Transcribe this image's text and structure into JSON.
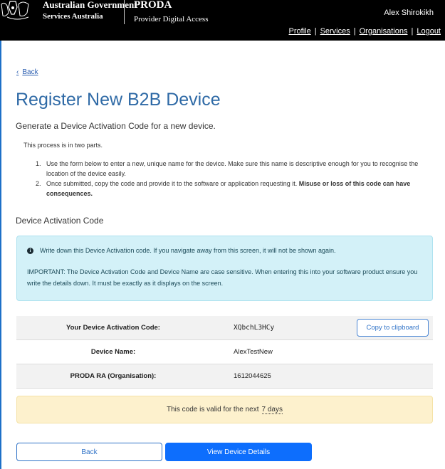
{
  "header": {
    "gov_name": "Australian Government",
    "gov_sub": "Services Australia",
    "app_name": "PRODA",
    "app_sub": "Provider Digital Access",
    "user_name": "Alex Shirokikh",
    "links": [
      "Profile",
      "Services",
      "Organisations",
      "Logout"
    ],
    "link_separator": "|",
    "crest_icon": "coat-of-arms-icon"
  },
  "nav": {
    "back_label": "Back",
    "back_icon": "chevron-left-icon"
  },
  "page": {
    "title": "Register New B2B Device",
    "lead": "Generate a Device Activation Code for a new device.",
    "intro": "This process is in two parts.",
    "steps": [
      {
        "num": "1.",
        "text": "Use the form below to enter a new, unique name for the device. Make sure this name is descriptive enough for you to recognise the location of the device easily.",
        "bold": ""
      },
      {
        "num": "2.",
        "text": "Once submitted, copy the code and provide it to the software or application requesting it.",
        "bold": "Misuse or loss of this code can have consequences."
      }
    ],
    "section_heading": "Device Activation Code"
  },
  "info_alert": {
    "icon": "info-circle-icon",
    "line1": "Write down this Device Activation code. If you navigate away from this screen, it will not be shown again.",
    "line2": "IMPORTANT: The Device Activation Code and Device Name are case sensitive. When entering this into your software product ensure you write the details down. It must be exactly as it displays on the screen."
  },
  "details": [
    {
      "label": "Your Device Activation Code:",
      "value": "XQbchL3HCy"
    },
    {
      "label": "Device Name:",
      "value": "AlexTestNew"
    },
    {
      "label": "PRODA RA (Organisation):",
      "value": "1612044625"
    }
  ],
  "copy_button": "Copy to clipboard",
  "validity": {
    "text": "This code is valid for the next",
    "duration": "7 days"
  },
  "buttons": {
    "back": "Back",
    "view": "View Device Details"
  },
  "colors": {
    "header_bg": "#000000",
    "title": "#2f6aa6",
    "info_bg": "#d3f1f8",
    "warn_bg": "#fdf1cd",
    "primary": "#0d6efd"
  }
}
